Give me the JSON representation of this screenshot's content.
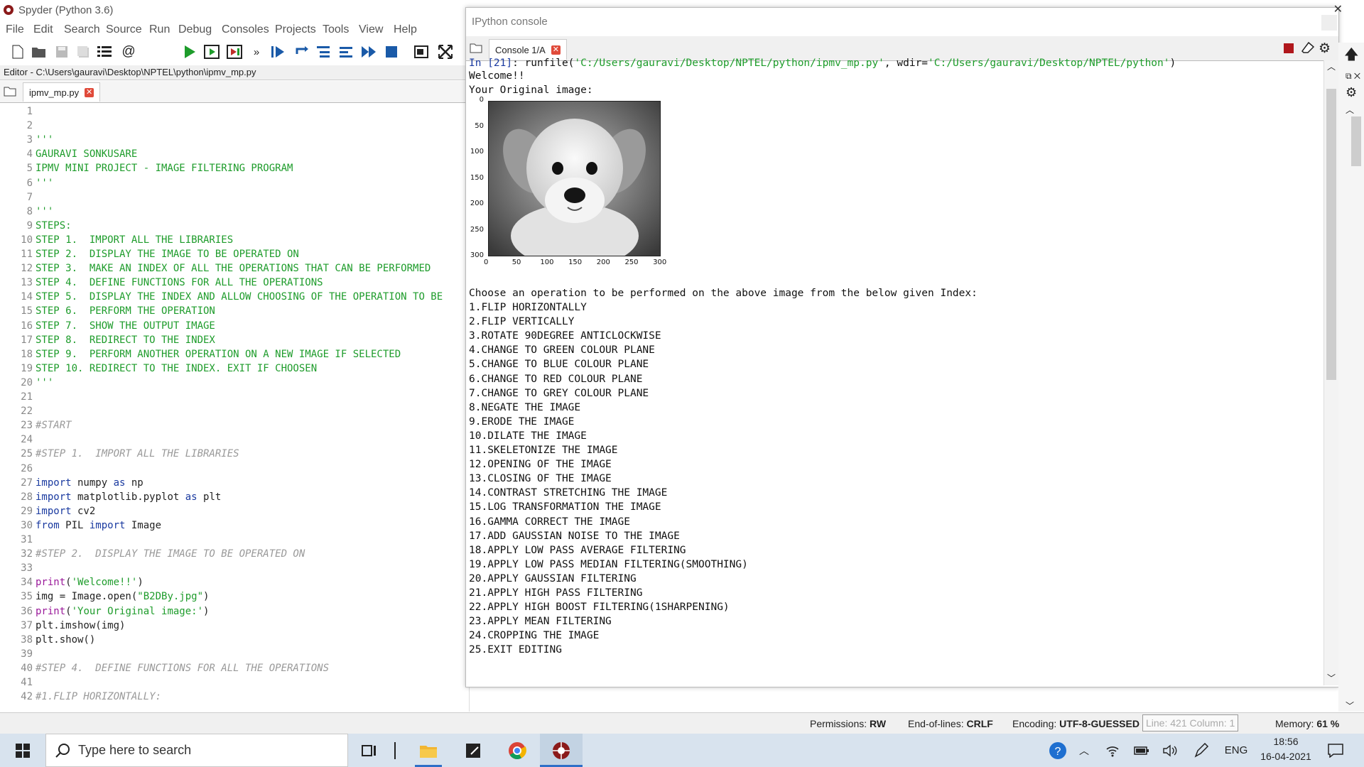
{
  "window": {
    "title": "Spyder (Python 3.6)"
  },
  "menu": [
    "File",
    "Edit",
    "Search",
    "Source",
    "Run",
    "Debug",
    "Consoles",
    "Projects",
    "Tools",
    "View",
    "Help"
  ],
  "editor": {
    "path": "Editor - C:\\Users\\gauravi\\Desktop\\NPTEL\\python\\ipmv_mp.py",
    "tab": "ipmv_mp.py",
    "line_numbers": [
      "1",
      "2",
      "3",
      "4",
      "5",
      "6",
      "7",
      "8",
      "9",
      "10",
      "11",
      "12",
      "13",
      "14",
      "15",
      "16",
      "17",
      "18",
      "19",
      "20",
      "21",
      "22",
      "23",
      "24",
      "25",
      "26",
      "27",
      "28",
      "29",
      "30",
      "31",
      "32",
      "33",
      "34",
      "35",
      "36",
      "37",
      "38",
      "39",
      "40",
      "41",
      "42"
    ],
    "lines": [
      "",
      "",
      "'''",
      "GAURAVI SONKUSARE",
      "IPMV MINI PROJECT - IMAGE FILTERING PROGRAM",
      "'''",
      "",
      "'''",
      "STEPS:",
      "STEP 1.  IMPORT ALL THE LIBRARIES",
      "STEP 2.  DISPLAY THE IMAGE TO BE OPERATED ON",
      "STEP 3.  MAKE AN INDEX OF ALL THE OPERATIONS THAT CAN BE PERFORMED",
      "STEP 4.  DEFINE FUNCTIONS FOR ALL THE OPERATIONS",
      "STEP 5.  DISPLAY THE INDEX AND ALLOW CHOOSING OF THE OPERATION TO BE",
      "STEP 6.  PERFORM THE OPERATION",
      "STEP 7.  SHOW THE OUTPUT IMAGE",
      "STEP 8.  REDIRECT TO THE INDEX",
      "STEP 9.  PERFORM ANOTHER OPERATION ON A NEW IMAGE IF SELECTED",
      "STEP 10. REDIRECT TO THE INDEX. EXIT IF CHOOSEN",
      "'''",
      "",
      "",
      "#START",
      "",
      "#STEP 1.  IMPORT ALL THE LIBRARIES",
      "",
      "import numpy as np",
      "import matplotlib.pyplot as plt",
      "import cv2",
      "from PIL import Image",
      "",
      "#STEP 2.  DISPLAY THE IMAGE TO BE OPERATED ON",
      "",
      "print('Welcome!!')",
      "img = Image.open(\"B2DBy.jpg\")",
      "print('Your Original image:')",
      "plt.imshow(img)",
      "plt.show()",
      "",
      "#STEP 4.  DEFINE FUNCTIONS FOR ALL THE OPERATIONS",
      "",
      "#1.FLIP HORIZONTALLY:"
    ]
  },
  "console": {
    "pane_title": "IPython console",
    "tab": "Console 1/A",
    "run_line": "In [21]: runfile('C:/Users/gauravi/Desktop/NPTEL/python/ipmv_mp.py', wdir='C:/Users/gauravi/Desktop/NPTEL/python')",
    "welcome": "Welcome!!",
    "original_image": "Your Original image:",
    "plot": {
      "y_ticks": [
        "0",
        "50",
        "100",
        "150",
        "200",
        "250",
        "300"
      ],
      "x_ticks": [
        "0",
        "50",
        "100",
        "150",
        "200",
        "250",
        "300"
      ]
    },
    "prompt": "Choose an operation to be performed on the above image from the below given Index:",
    "options": [
      "1.FLIP HORIZONTALLY",
      "2.FLIP VERTICALLY",
      "3.ROTATE 90DEGREE ANTICLOCKWISE",
      "4.CHANGE TO GREEN COLOUR PLANE",
      "5.CHANGE TO BLUE COLOUR PLANE",
      "6.CHANGE TO RED COLOUR PLANE",
      "7.CHANGE TO GREY COLOUR PLANE",
      "8.NEGATE THE IMAGE",
      "9.ERODE THE IMAGE",
      "10.DILATE THE IMAGE",
      "11.SKELETONIZE THE IMAGE",
      "12.OPENING OF THE IMAGE",
      "13.CLOSING OF THE IMAGE",
      "14.CONTRAST STRETCHING THE IMAGE",
      "15.LOG TRANSFORMATION THE IMAGE",
      "16.GAMMA CORRECT THE IMAGE",
      "17.ADD GAUSSIAN NOISE TO THE IMAGE",
      "18.APPLY LOW PASS AVERAGE FILTERING",
      "19.APPLY LOW PASS MEDIAN FILTERING(SMOOTHING)",
      "20.APPLY GAUSSIAN FILTERING",
      "21.APPLY HIGH PASS FILTERING",
      "22.APPLY HIGH BOOST FILTERING(1SHARPENING)",
      "23.APPLY MEAN FILTERING",
      "24.CROPPING THE IMAGE",
      "25.EXIT EDITING"
    ]
  },
  "status": {
    "permissions_label": "Permissions:",
    "permissions": "RW",
    "eol_label": "End-of-lines:",
    "eol": "CRLF",
    "encoding_label": "Encoding:",
    "encoding": "UTF-8-GUESSED",
    "line_label": "Line: 421",
    "column_label": "Column: 1",
    "memory_label": "Memory:",
    "memory": "61 %"
  },
  "taskbar": {
    "search_placeholder": "Type here to search",
    "lang": "ENG",
    "time": "18:56",
    "date": "16-04-2021"
  },
  "colors": {
    "accent": "#1e9c2b",
    "keyword": "#1a3aa0",
    "string_fn": "#9a1a9a",
    "close": "#e04a3a"
  }
}
